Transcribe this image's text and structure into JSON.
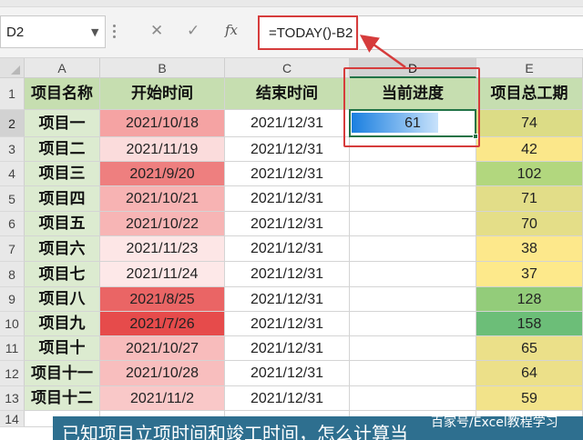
{
  "formula_bar": {
    "name_box": "D2",
    "cancel_symbol": "✕",
    "enter_symbol": "✓",
    "fx_label": "fx",
    "formula": "=TODAY()-B2"
  },
  "columns": [
    "A",
    "B",
    "C",
    "D",
    "E"
  ],
  "rows": [
    "1",
    "2",
    "3",
    "4",
    "5",
    "6",
    "7",
    "8",
    "9",
    "10",
    "11",
    "12",
    "13",
    "14"
  ],
  "headers": [
    "项目名称",
    "开始时间",
    "结束时间",
    "当前进度",
    "项目总工期"
  ],
  "table_rows": [
    {
      "name": "项目一",
      "start": "2021/10/18",
      "end": "2021/12/31",
      "progress": "61",
      "total": "74",
      "start_color": "#f5a3a3",
      "total_color": "#dcdc86"
    },
    {
      "name": "项目二",
      "start": "2021/11/19",
      "end": "2021/12/31",
      "progress": "",
      "total": "42",
      "start_color": "#fbdcdc",
      "total_color": "#fbe78a"
    },
    {
      "name": "项目三",
      "start": "2021/9/20",
      "end": "2021/12/31",
      "progress": "",
      "total": "102",
      "start_color": "#ee7f7f",
      "total_color": "#b2d77e"
    },
    {
      "name": "项目四",
      "start": "2021/10/21",
      "end": "2021/12/31",
      "progress": "",
      "total": "71",
      "start_color": "#f7b3b3",
      "total_color": "#e2dd88"
    },
    {
      "name": "项目五",
      "start": "2021/10/22",
      "end": "2021/12/31",
      "progress": "",
      "total": "70",
      "start_color": "#f7b5b5",
      "total_color": "#e4de88"
    },
    {
      "name": "项目六",
      "start": "2021/11/23",
      "end": "2021/12/31",
      "progress": "",
      "total": "38",
      "start_color": "#fde6e6",
      "total_color": "#fde88b"
    },
    {
      "name": "项目七",
      "start": "2021/11/24",
      "end": "2021/12/31",
      "progress": "",
      "total": "37",
      "start_color": "#fde8e8",
      "total_color": "#fde98b"
    },
    {
      "name": "项目八",
      "start": "2021/8/25",
      "end": "2021/12/31",
      "progress": "",
      "total": "128",
      "start_color": "#ea6565",
      "total_color": "#93cc7a"
    },
    {
      "name": "项目九",
      "start": "2021/7/26",
      "end": "2021/12/31",
      "progress": "",
      "total": "158",
      "start_color": "#e64b4b",
      "total_color": "#6cbe78"
    },
    {
      "name": "项目十",
      "start": "2021/10/27",
      "end": "2021/12/31",
      "progress": "",
      "total": "65",
      "start_color": "#f8bcbc",
      "total_color": "#ebe089"
    },
    {
      "name": "项目十一",
      "start": "2021/10/28",
      "end": "2021/12/31",
      "progress": "",
      "total": "64",
      "start_color": "#f8bebe",
      "total_color": "#ece089"
    },
    {
      "name": "项目十二",
      "start": "2021/11/2",
      "end": "2021/12/31",
      "progress": "",
      "total": "59",
      "start_color": "#f9c8c8",
      "total_color": "#f2e38a"
    }
  ],
  "progress_bar": {
    "fraction": 0.4
  },
  "banner": {
    "text": "已知项目立项时间和竣工时间，怎么计算当",
    "watermark": "百家号/Excel教程学习"
  },
  "colors": {
    "accent_red": "#d63c3c",
    "excel_green": "#217346",
    "header_green": "#c6deb0",
    "data_bar_blue": "#1a7fe0"
  }
}
